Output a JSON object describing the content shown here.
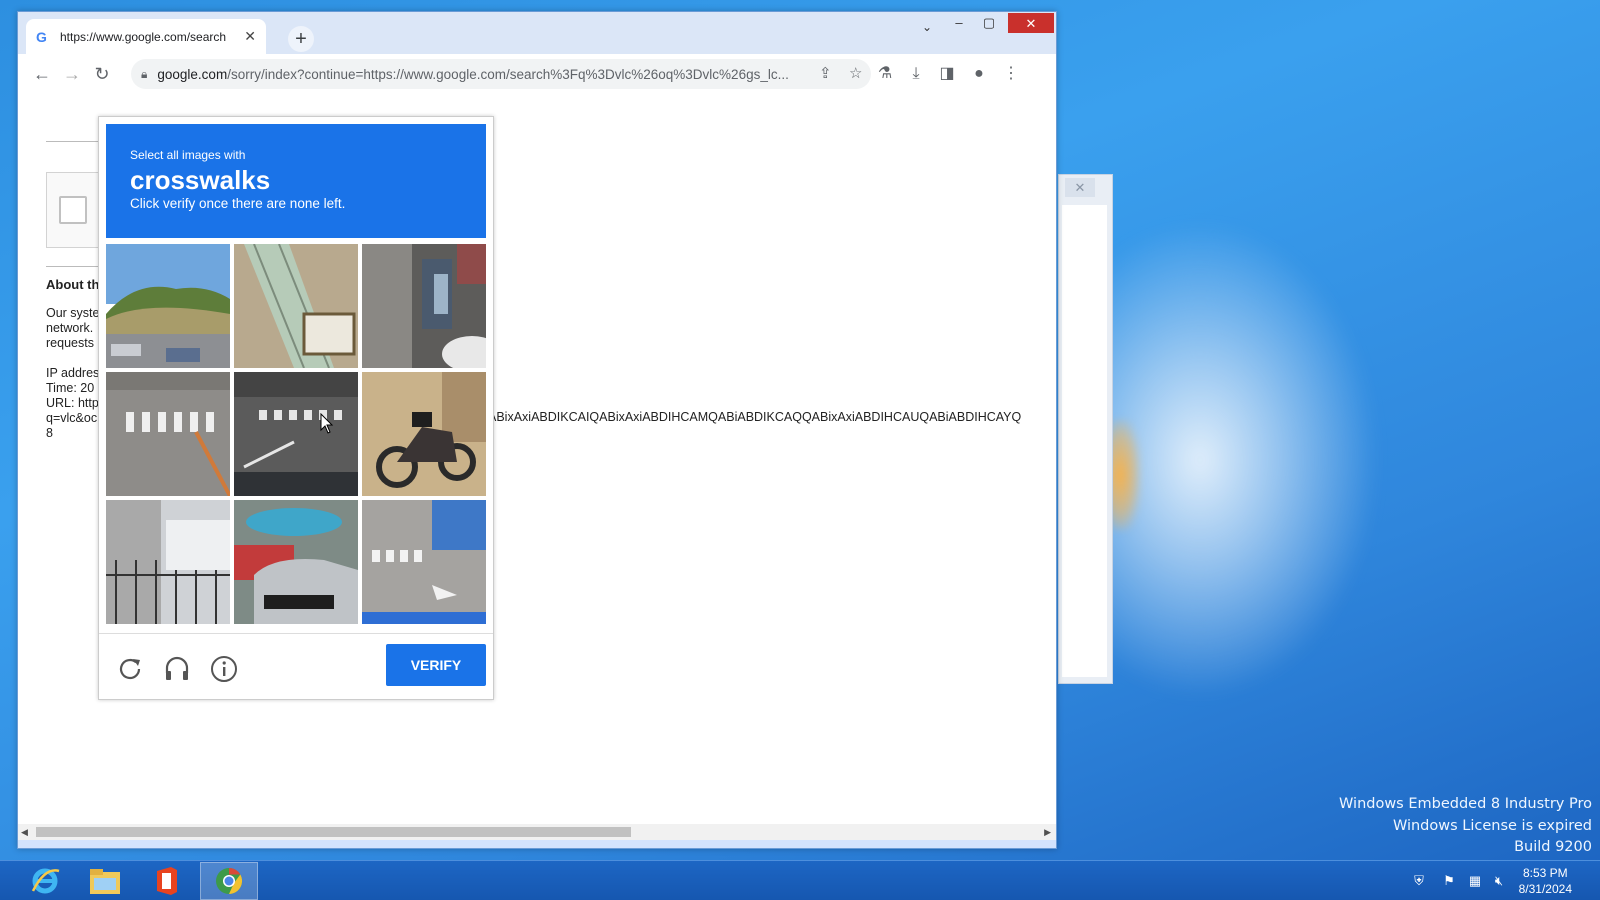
{
  "desktop": {
    "watermark": [
      "Windows Embedded 8 Industry Pro",
      "Windows License is expired",
      "Build 9200"
    ]
  },
  "browser": {
    "tab_title": "https://www.google.com/search",
    "tab_favicon": "G",
    "url_host": "google.com",
    "url_path": "/sorry/index?continue=https://www.google.com/search%3Fq%3Dvlc%26oq%3Dvlc%26gs_lc...",
    "new_tab_label": "+"
  },
  "page": {
    "about_heading": "About th",
    "body_lines": [
      "Our syste",
      "network.",
      "requests"
    ],
    "info_lines": [
      "IP addres",
      "Time: 20",
      "URL: http",
      "q=vlc&oc",
      "8"
    ],
    "long_param": "ABixAxiABDIKCAIQABixAxiABDIHCAMQABiABDIKCAQQABixAxiABDIHCAUQABiABDIHCAYQ"
  },
  "captcha": {
    "instruction_small": "Select all images with",
    "target": "crosswalks",
    "instruction_sub": "Click verify once there are none left.",
    "verify_label": "VERIFY",
    "tiles": [
      {
        "name": "tile-road-hillside"
      },
      {
        "name": "tile-stairs-railing"
      },
      {
        "name": "tile-shop-entrance"
      },
      {
        "name": "tile-crosswalk-lane"
      },
      {
        "name": "tile-crosswalk-intersection"
      },
      {
        "name": "tile-motorcycle"
      },
      {
        "name": "tile-gate-building"
      },
      {
        "name": "tile-parked-cars"
      },
      {
        "name": "tile-crosswalk-street"
      }
    ]
  },
  "taskbar": {
    "apps": [
      "internet-explorer-icon",
      "file-explorer-icon",
      "office-icon",
      "chrome-icon"
    ],
    "time": "8:53 PM",
    "date": "8/31/2024"
  },
  "colors": {
    "accent": "#1a73e8",
    "close_red": "#c9302c",
    "taskbar": "#1d66c4"
  }
}
